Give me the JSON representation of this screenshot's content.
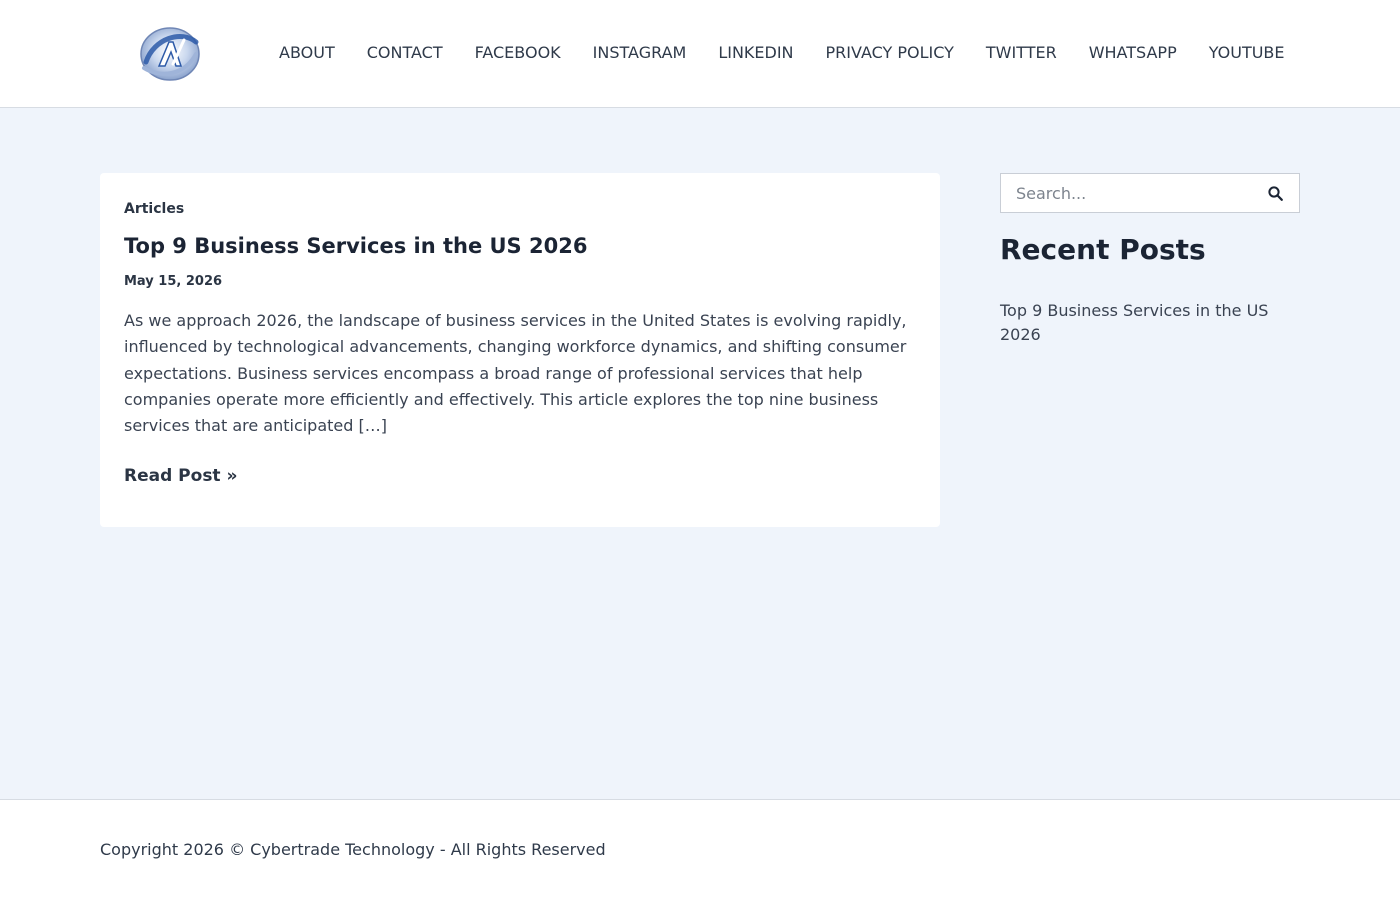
{
  "header": {
    "logo_icon": "circular-swoosh-logo-icon",
    "nav": [
      {
        "label": "ABOUT"
      },
      {
        "label": "CONTACT"
      },
      {
        "label": "FACEBOOK"
      },
      {
        "label": "INSTAGRAM"
      },
      {
        "label": "LINKEDIN"
      },
      {
        "label": "PRIVACY POLICY"
      },
      {
        "label": "TWITTER"
      },
      {
        "label": "WHATSAPP"
      },
      {
        "label": "YOUTUBE"
      }
    ]
  },
  "post": {
    "category": "Articles",
    "title": "Top 9 Business Services in the US 2026",
    "date": "May 15, 2026",
    "excerpt": "As we approach 2026, the landscape of business services in the United States is evolving rapidly, influenced by technological advancements, changing workforce dynamics, and shifting consumer expectations. Business services encompass a broad range of professional services that help companies operate more efficiently and effectively. This article explores the top nine business services that are anticipated […]",
    "read_more": "Read Post »"
  },
  "sidebar": {
    "search": {
      "placeholder": "Search...",
      "value": "",
      "icon": "search-icon"
    },
    "recent_heading": "Recent Posts",
    "recent_posts": [
      {
        "label": "Top 9 Business Services in the US 2026"
      }
    ]
  },
  "footer": {
    "copyright": "Copyright 2026 © Cybertrade Technology - All Rights Reserved"
  },
  "colors": {
    "page_background": "#eff4fb",
    "surface": "#ffffff",
    "heading_text": "#1b2434",
    "body_text": "#3a4352",
    "logo_blue": "#2d5aa8"
  }
}
